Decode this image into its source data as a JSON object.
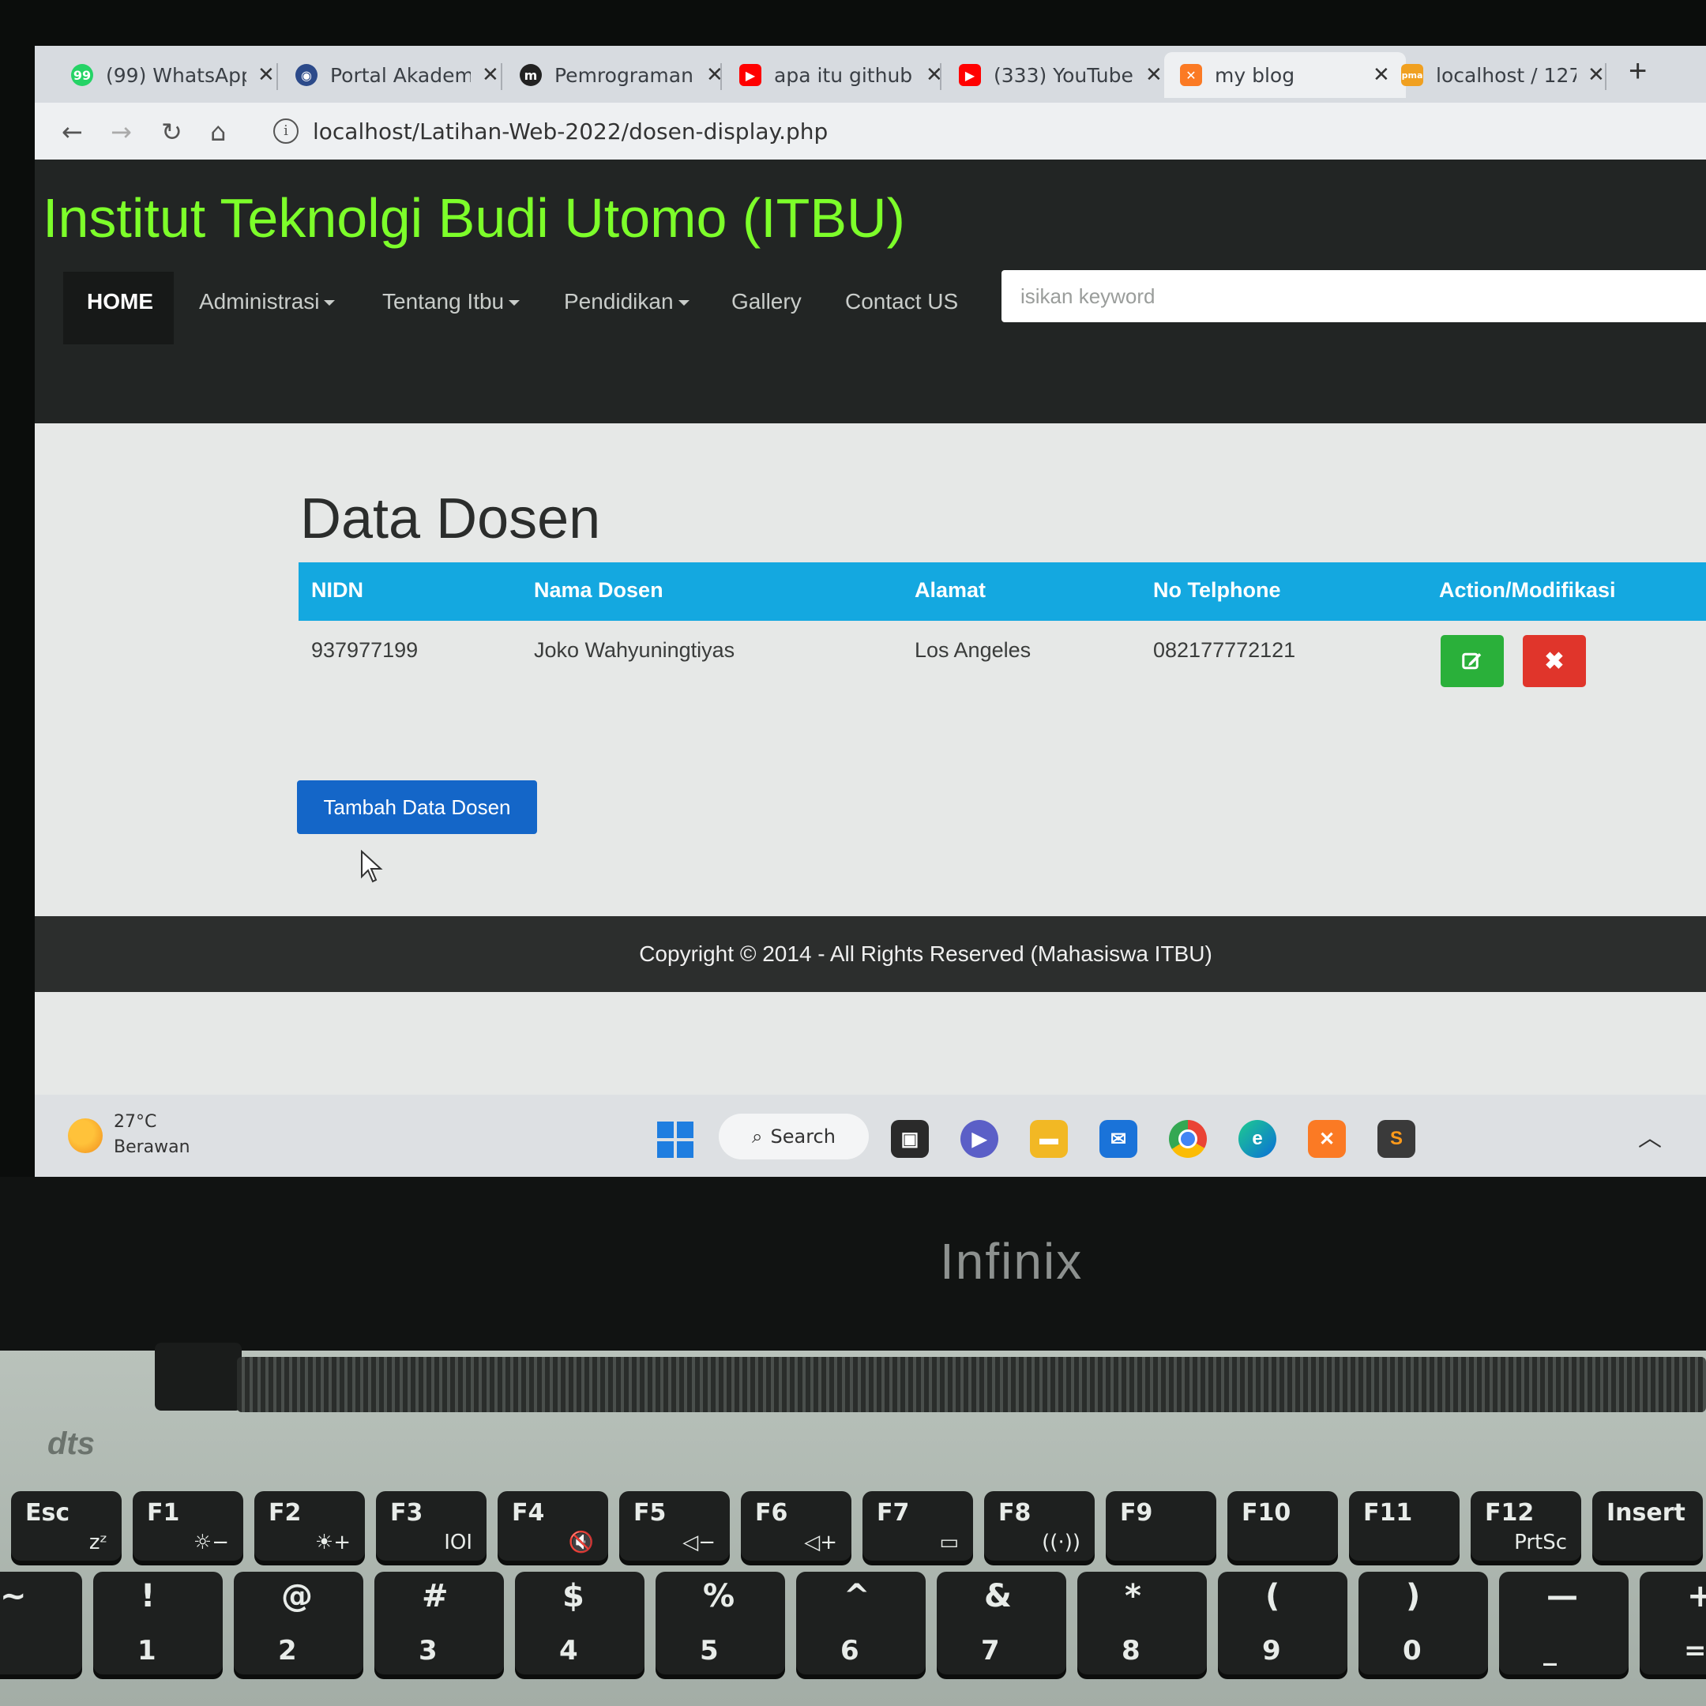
{
  "browser": {
    "tabs": [
      {
        "title": "(99) WhatsApp",
        "favicon": "whatsapp-icon",
        "color": "#25d366",
        "glyph": "99"
      },
      {
        "title": "Portal Akadem",
        "favicon": "portal-icon",
        "color": "#2c4a8a",
        "glyph": "◉"
      },
      {
        "title": "Pemrograman",
        "favicon": "medium-icon",
        "color": "#222222",
        "glyph": "m"
      },
      {
        "title": "apa itu github",
        "favicon": "youtube-icon",
        "color": "#ff0000",
        "glyph": "▶"
      },
      {
        "title": "(333) YouTube",
        "favicon": "youtube-icon",
        "color": "#ff0000",
        "glyph": "▶"
      },
      {
        "title": "my blog",
        "favicon": "xampp-icon",
        "color": "#fb7a24",
        "glyph": "✕"
      },
      {
        "title": "localhost / 127",
        "favicon": "phpmyadmin-icon",
        "color": "#f0a020",
        "glyph": "pma"
      }
    ],
    "url": "localhost/Latihan-Web-2022/dosen-display.php"
  },
  "header": {
    "title": "Institut Teknolgi Budi Utomo (ITBU)",
    "nav": {
      "home": "HOME",
      "administrasi": "Administrasi",
      "tentang": "Tentang Itbu",
      "pendidikan": "Pendidikan",
      "gallery": "Gallery",
      "contact": "Contact US"
    },
    "search_placeholder": "isikan keyword",
    "title_color": "#7dff2a"
  },
  "main": {
    "page_title": "Data Dosen",
    "table": {
      "columns": [
        "NIDN",
        "Nama Dosen",
        "Alamat",
        "No Telphone",
        "Action/Modifikasi"
      ],
      "rows": [
        {
          "nidn": "937977199",
          "nama": "Joko Wahyuningtiyas",
          "alamat": "Los Angeles",
          "telp": "082177772121"
        }
      ],
      "header_color": "#14a8e0"
    },
    "add_button": "Tambah Data Dosen"
  },
  "footer": {
    "copyright": "Copyright © 2014 - All Rights Reserved (Mahasiswa ITBU)"
  },
  "taskbar": {
    "temperature": "27°C",
    "weather": "Berawan",
    "search": "Search"
  },
  "laptop": {
    "brand": "Infinix",
    "audio_logo": "dts"
  },
  "keyboard": {
    "fn_row": [
      {
        "top": "Esc",
        "bot": "zᶻ"
      },
      {
        "top": "F1",
        "bot": "☼−"
      },
      {
        "top": "F2",
        "bot": "☀+"
      },
      {
        "top": "F3",
        "bot": "IOI"
      },
      {
        "top": "F4",
        "bot": "🔇"
      },
      {
        "top": "F5",
        "bot": "◁−"
      },
      {
        "top": "F6",
        "bot": "◁+"
      },
      {
        "top": "F7",
        "bot": "▭"
      },
      {
        "top": "F8",
        "bot": "((·))"
      },
      {
        "top": "F9",
        "bot": ""
      },
      {
        "top": "F10",
        "bot": ""
      },
      {
        "top": "F11",
        "bot": ""
      },
      {
        "top": "F12",
        "bot": "PrtSc"
      },
      {
        "top": "Insert",
        "bot": ""
      }
    ],
    "num_row": [
      {
        "top": "~",
        "bot": ""
      },
      {
        "top": "!",
        "bot": "1"
      },
      {
        "top": "@",
        "bot": "2"
      },
      {
        "top": "#",
        "bot": "3"
      },
      {
        "top": "$",
        "bot": "4"
      },
      {
        "top": "%",
        "bot": "5"
      },
      {
        "top": "^",
        "bot": "6"
      },
      {
        "top": "&",
        "bot": "7"
      },
      {
        "top": "*",
        "bot": "8"
      },
      {
        "top": "(",
        "bot": "9"
      },
      {
        "top": ")",
        "bot": "0"
      },
      {
        "top": "—",
        "bot": "_"
      },
      {
        "top": "+",
        "bot": "="
      }
    ]
  }
}
